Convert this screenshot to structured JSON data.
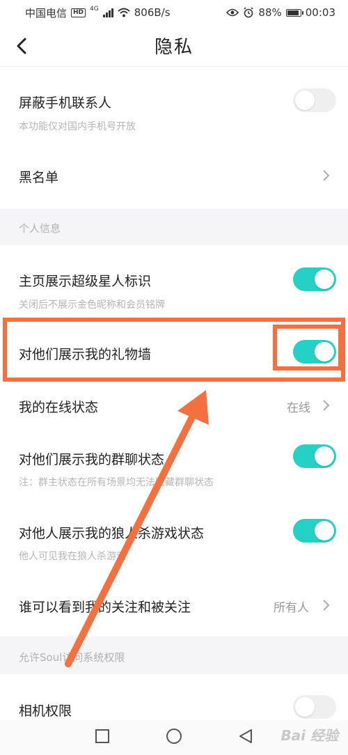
{
  "status_bar": {
    "carrier": "中国电信",
    "hd": "HD",
    "network": "4G",
    "speed": "806B/s",
    "battery": "88%",
    "time": "00:03"
  },
  "header": {
    "title": "隐私"
  },
  "items": {
    "block_contacts": {
      "title": "屏蔽手机联系人",
      "subtitle": "本功能仅对国内手机号开放",
      "on": false
    },
    "blacklist": {
      "title": "黑名单"
    },
    "section_personal": "个人信息",
    "superstar": {
      "title": "主页展示超级星人标识",
      "subtitle": "关闭后不展示金色昵称和会员铭牌",
      "on": true
    },
    "gift_wall": {
      "title": "对他们展示我的礼物墙",
      "on": true
    },
    "online_status": {
      "title": "我的在线状态",
      "value": "在线"
    },
    "group_chat": {
      "title": "对他们展示我的群聊状态",
      "subtitle": "注：群主状态在所有场景均无法隐藏群聊状态",
      "on": true
    },
    "werewolf": {
      "title": "对他人展示我的狼人杀游戏状态",
      "subtitle": "他人可见我在狼人杀游戏",
      "on": true
    },
    "follow_visibility": {
      "title": "谁可以看到我的关注和被关注",
      "value": "所有人"
    },
    "section_permissions": "允许Soul访问系统权限",
    "camera": {
      "title": "相机权限",
      "on": false
    }
  },
  "watermark": "Bai 经验",
  "colors": {
    "toggle_on": "#25d1c4",
    "highlight": "#f4703f",
    "section_bg": "#f5f5f7"
  }
}
